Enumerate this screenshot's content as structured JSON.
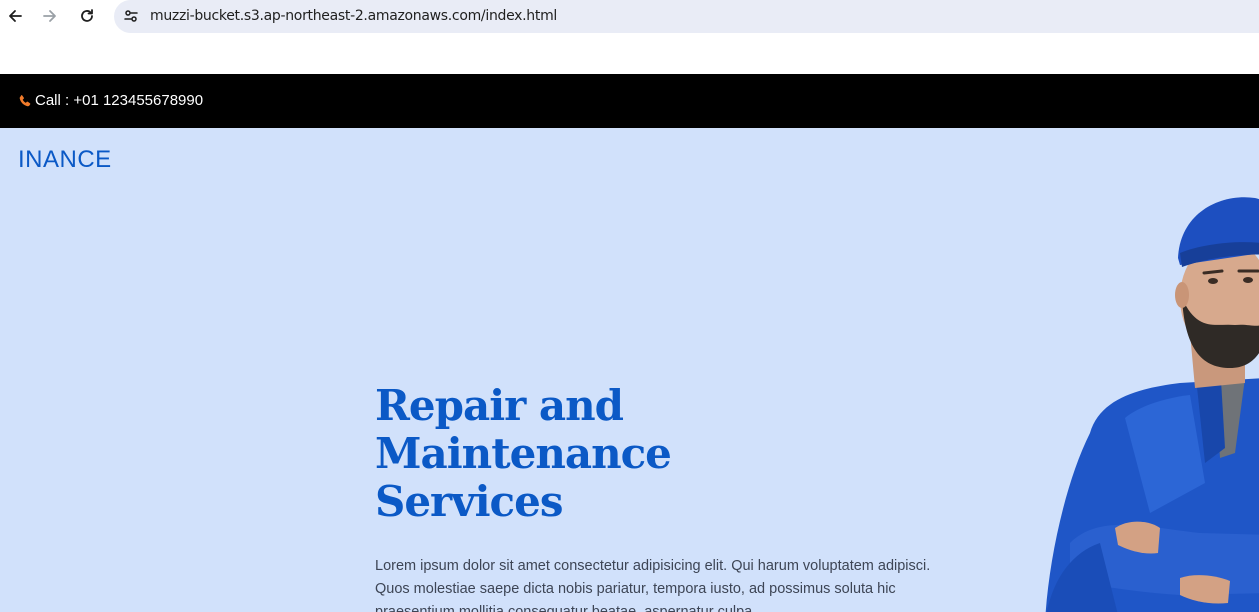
{
  "browser": {
    "url": "muzzi-bucket.s3.ap-northeast-2.amazonaws.com/index.html",
    "back_icon": "arrow-left-icon",
    "forward_icon": "arrow-right-icon",
    "reload_icon": "reload-icon",
    "site_info_icon": "tune-icon"
  },
  "topbar": {
    "call_text": "Call : +01 123455678990",
    "call_icon": "phone-icon",
    "icon_color": "#f07b2b"
  },
  "hero": {
    "brand": "INANCE",
    "headline_lines": [
      "Repair and",
      "Maintenance",
      "Services"
    ],
    "body": "Lorem ipsum dolor sit amet consectetur adipisicing elit. Qui harum voluptatem adipisci. Quos molestiae saepe dicta nobis pariatur, tempora iusto, ad possimus soluta hic praesentium mollitia consequatur beatae, aspernatur culpa.",
    "accent_color": "#0b59c6",
    "background_color": "#d1e1fb"
  }
}
